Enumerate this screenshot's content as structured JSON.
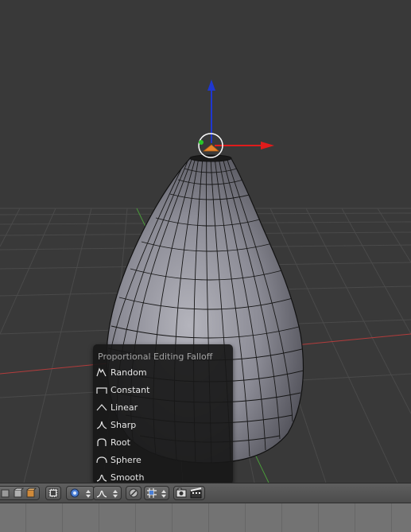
{
  "popup": {
    "title": "Proportional Editing Falloff",
    "items": [
      {
        "label": "Random",
        "icon": "random-falloff-icon"
      },
      {
        "label": "Constant",
        "icon": "constant-falloff-icon"
      },
      {
        "label": "Linear",
        "icon": "linear-falloff-icon"
      },
      {
        "label": "Sharp",
        "icon": "sharp-falloff-icon"
      },
      {
        "label": "Root",
        "icon": "root-falloff-icon"
      },
      {
        "label": "Sphere",
        "icon": "sphere-falloff-icon"
      },
      {
        "label": "Smooth",
        "icon": "smooth-falloff-icon"
      }
    ]
  },
  "toolbar": {
    "icons": [
      "vertex-select-mode-icon",
      "edge-select-mode-icon",
      "face-select-mode-icon",
      "limit-selection-to-visible-icon",
      "proportional-editing-icon",
      "falloff-smooth-icon",
      "snap-magnet-icon",
      "snap-increment-icon",
      "render-opengl-icon",
      "render-animation-icon"
    ]
  },
  "colors": {
    "viewport_bg": "#393939",
    "grid_line": "#4a4a4a",
    "axis_red": "#b33c3c",
    "axis_green": "#4a9a3a",
    "gizmo_z": "#1f37d0",
    "gizmo_x": "#e01c1c",
    "mesh_fill": "#8a8a92",
    "selected_vertex": "#e8842a"
  }
}
